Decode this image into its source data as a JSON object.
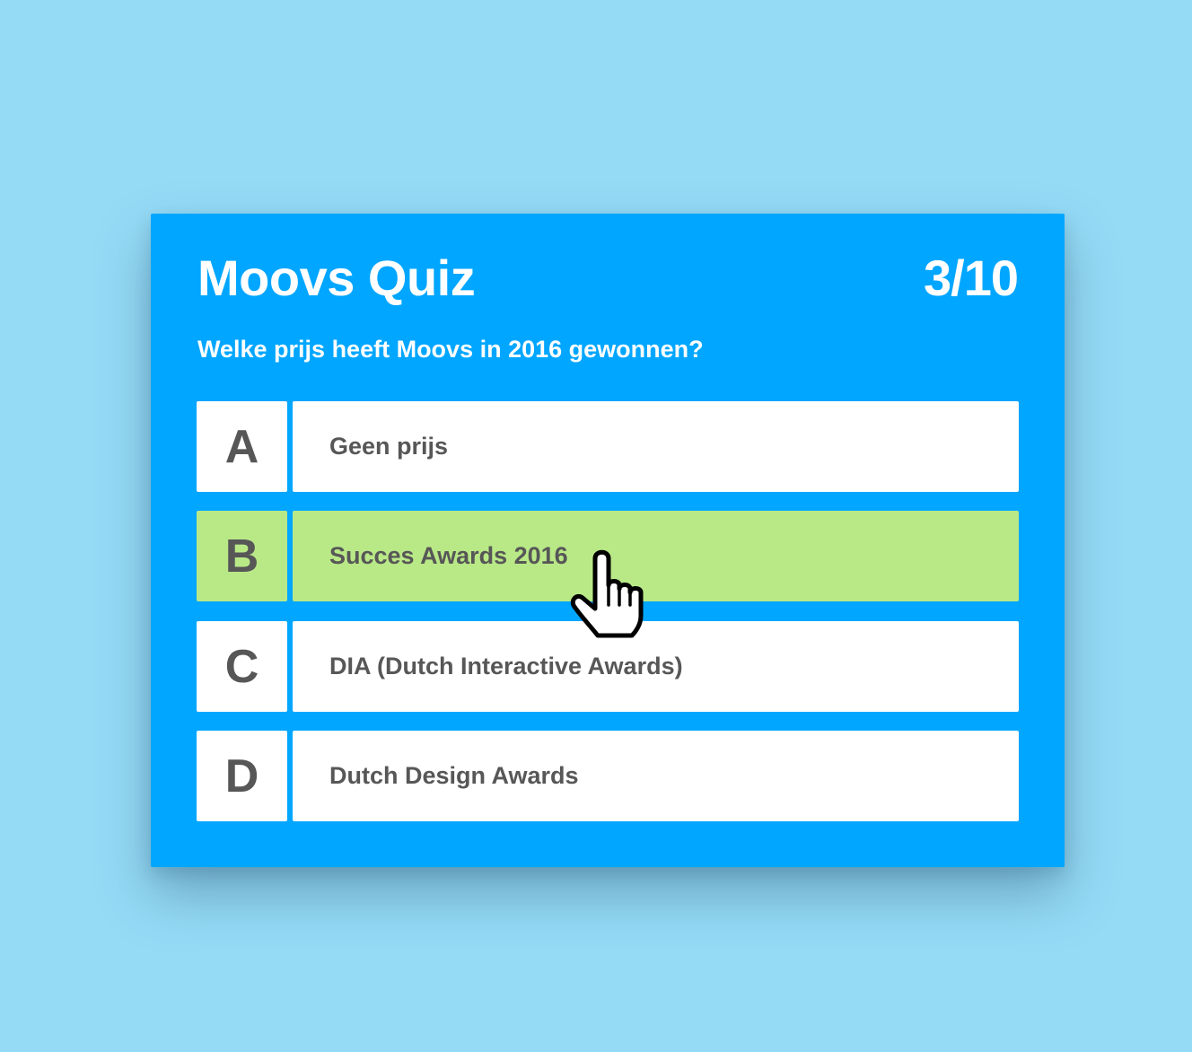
{
  "quiz": {
    "title": "Moovs Quiz",
    "progress": "3/10",
    "question": "Welke prijs heeft Moovs in 2016 gewonnen?",
    "selected_answer": "B",
    "answers": [
      {
        "letter": "A",
        "text": "Geen prijs"
      },
      {
        "letter": "B",
        "text": "Succes Awards 2016"
      },
      {
        "letter": "C",
        "text": "DIA (Dutch Interactive Awards)"
      },
      {
        "letter": "D",
        "text": "Dutch Design Awards"
      }
    ]
  },
  "colors": {
    "page_background": "#95dbf6",
    "card_background": "#00a6ff",
    "answer_background": "#ffffff",
    "selected_background": "#b9e987",
    "answer_text": "#575757"
  },
  "cursor": {
    "icon": "hand-pointer-icon"
  }
}
